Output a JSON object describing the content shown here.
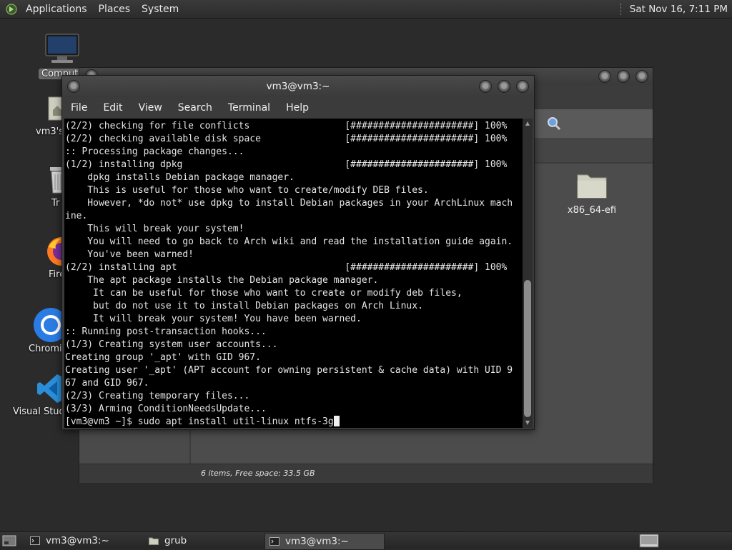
{
  "top_panel": {
    "menus": [
      "Applications",
      "Places",
      "System"
    ],
    "clock": "Sat Nov 16, 7:11 PM"
  },
  "desktop_icons": [
    {
      "label": "Comput",
      "icon": "computer-icon"
    },
    {
      "label": "vm3's",
      "icon": "home-folder-icon"
    },
    {
      "label": "Tr",
      "icon": "trash-icon"
    },
    {
      "label": "Fire",
      "icon": "firefox-icon"
    },
    {
      "label": "Chromi",
      "icon": "chromium-icon"
    },
    {
      "label": "Visual Studi",
      "icon": "vscode-icon"
    }
  ],
  "file_manager": {
    "folder_label": "x86_64-efi",
    "status": "6 items, Free space: 33.5 GB"
  },
  "terminal": {
    "title": "vm3@vm3:~",
    "menus": [
      "File",
      "Edit",
      "View",
      "Search",
      "Terminal",
      "Help"
    ],
    "lines": [
      "(2/2) checking for file conflicts                 [######################] 100%",
      "(2/2) checking available disk space               [######################] 100%",
      ":: Processing package changes...",
      "(1/2) installing dpkg                             [######################] 100%",
      "    dpkg installs Debian package manager.",
      "    This is useful for those who want to create/modify DEB files.",
      "    However, *do not* use dpkg to install Debian packages in your ArchLinux mach",
      "ine.",
      "    This will break your system!",
      "    You will need to go back to Arch wiki and read the installation guide again.",
      "    You've been warned!",
      "(2/2) installing apt                              [######################] 100%",
      "    The apt package installs the Debian package manager.",
      "     It can be useful for those who want to create or modify deb files,",
      "     but do not use it to install Debian packages on Arch Linux.",
      "     It will break your system! You have been warned.",
      ":: Running post-transaction hooks...",
      "(1/3) Creating system user accounts...",
      "Creating group '_apt' with GID 967.",
      "Creating user '_apt' (APT account for owning persistent & cache data) with UID 9",
      "67 and GID 967.",
      "(2/3) Creating temporary files...",
      "(3/3) Arming ConditionNeedsUpdate..."
    ],
    "prompt": "[vm3@vm3 ~]$ sudo apt install util-linux ntfs-3g"
  },
  "taskbar": {
    "tasks": [
      {
        "label": "vm3@vm3:~",
        "icon": "terminal-icon",
        "active": false
      },
      {
        "label": "grub",
        "icon": "folder-icon",
        "active": false
      },
      {
        "label": "vm3@vm3:~",
        "icon": "terminal-icon",
        "active": true
      }
    ]
  },
  "colors": {
    "terminal_bg": "#000000",
    "terminal_fg": "#e6e6e6",
    "panel_bg": "#2f2f2f",
    "desktop_bg": "#2b2b2b"
  }
}
